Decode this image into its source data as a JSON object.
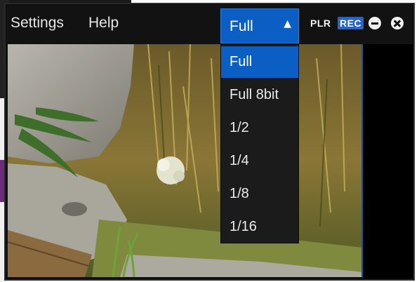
{
  "menu": {
    "settings": "Settings",
    "help": "Help"
  },
  "resolution": {
    "current": "Full",
    "options": [
      "Full",
      "Full 8bit",
      "1/2",
      "1/4",
      "1/8",
      "1/16"
    ],
    "selected_index": 0
  },
  "controls": {
    "player": "PLR",
    "record": "REC"
  },
  "icons": {
    "dropdown_arrow": "triangle-up-icon",
    "minimize": "minus-circle-icon",
    "close": "close-circle-icon"
  },
  "colors": {
    "accent": "#0b5fc4",
    "background": "#121212",
    "rec_badge": "#2a63c6"
  }
}
